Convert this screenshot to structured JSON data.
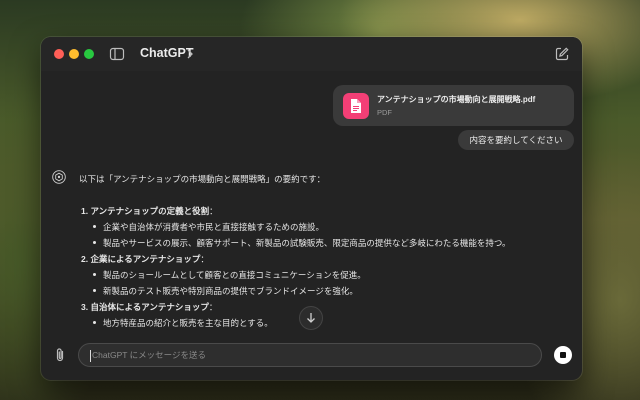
{
  "window": {
    "title": "ChatGPT"
  },
  "conversation": {
    "attachment": {
      "file_name": "アンテナショップの市場動向と展開戦略.pdf",
      "file_type": "PDF"
    },
    "user_message": "内容を要約してください",
    "assistant": {
      "intro": "以下は「アンテナショップの市場動向と展開戦略」の要約です：",
      "sections": [
        {
          "number": "1.",
          "heading": "アンテナショップの定義と役割",
          "suffix": "：",
          "bullets": [
            "企業や自治体が消費者や市民と直接接触するための施設。",
            "製品やサービスの展示、顧客サポート、新製品の試験販売、限定商品の提供など多岐にわたる機能を持つ。"
          ]
        },
        {
          "number": "2.",
          "heading": "企業によるアンテナショップ",
          "suffix": "：",
          "bullets": [
            "製品のショールームとして顧客との直接コミュニケーションを促進。",
            "新製品のテスト販売や特別商品の提供でブランドイメージを強化。"
          ]
        },
        {
          "number": "3.",
          "heading": "自治体によるアンテナショップ",
          "suffix": "：",
          "bullets": [
            "地方特産品の紹介と販売を主な目的とする。"
          ]
        }
      ]
    }
  },
  "composer": {
    "placeholder": "ChatGPT にメッセージを送る"
  },
  "icons": {
    "sidebar": "sidebar-toggle-icon",
    "new_chat": "compose-icon",
    "attach": "paperclip-icon",
    "stop": "stop-icon",
    "scroll": "arrow-down-icon"
  },
  "colors": {
    "window_bg": "#232323",
    "bubble_bg": "#3a3a3a",
    "pdf_icon": "#f33f76",
    "text": "#e6e6e6"
  }
}
